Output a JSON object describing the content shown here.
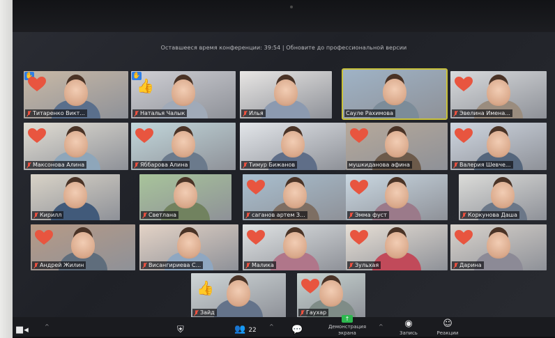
{
  "banner": "Оставшееся время конференции: 39:54 | Обновите до профессиональной версии",
  "tiles": [
    {
      "name": "Титаренко  Викт...",
      "reaction": "heart",
      "hand": true
    },
    {
      "name": "Наталья Чалык",
      "reaction": "thumb",
      "hand": true
    },
    {
      "name": "Илья",
      "reaction": "",
      "hand": false
    },
    {
      "name": "Сауле Рахимова",
      "reaction": "",
      "hand": false,
      "active": true
    },
    {
      "name": "Эвелина Имена...",
      "reaction": "heart",
      "hand": false
    },
    {
      "name": "Максонова Алина",
      "reaction": "heart",
      "hand": false
    },
    {
      "name": "Яббарова Алина",
      "reaction": "heart",
      "hand": false
    },
    {
      "name": "Тимур Бижанов",
      "reaction": "",
      "hand": false
    },
    {
      "name": "мушкиданова афина",
      "reaction": "heart",
      "hand": false
    },
    {
      "name": "Валерия Шевче...",
      "reaction": "heart",
      "hand": false
    },
    {
      "name": "Кирилл",
      "reaction": "",
      "hand": false
    },
    {
      "name": "Светлана",
      "reaction": "",
      "hand": false
    },
    {
      "name": "саганов артем З...",
      "reaction": "heart",
      "hand": false
    },
    {
      "name": "Эмма фуст",
      "reaction": "heart",
      "hand": false
    },
    {
      "name": "Коркунова Даша",
      "reaction": "",
      "hand": false
    },
    {
      "name": "Андрей Жилин",
      "reaction": "heart",
      "hand": false
    },
    {
      "name": "Висангириева С...",
      "reaction": "",
      "hand": false
    },
    {
      "name": "Малика",
      "reaction": "heart",
      "hand": false
    },
    {
      "name": "Зульхая",
      "reaction": "heart",
      "hand": false
    },
    {
      "name": "Дарина",
      "reaction": "heart",
      "hand": false
    },
    {
      "name": "Зайд",
      "reaction": "thumb",
      "hand": false
    },
    {
      "name": "Гаухар",
      "reaction": "heart",
      "hand": false
    }
  ],
  "toolbar": {
    "participants_count": "22",
    "share_label": "Демонстрация экрана",
    "record_label": "Запись",
    "reactions_label": "Реакции"
  },
  "colors": {
    "heart": "#e8553f",
    "thumb": "#f3b61f",
    "active_border": "#c9c23a",
    "hand_badge": "#2f7fe6"
  }
}
